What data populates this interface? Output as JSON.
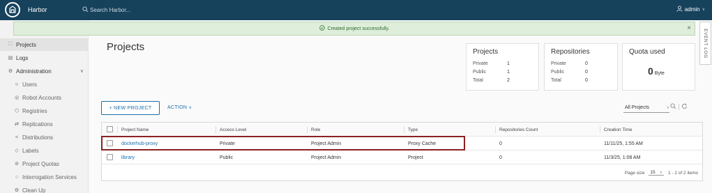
{
  "header": {
    "brand": "Harbor",
    "search_placeholder": "Search Harbor...",
    "user": "admin"
  },
  "sidebar": {
    "items": [
      {
        "label": "Projects",
        "icon": "projects-icon"
      },
      {
        "label": "Logs",
        "icon": "logs-icon"
      },
      {
        "label": "Administration",
        "icon": "administration-icon"
      },
      {
        "label": "Users",
        "icon": "users-icon"
      },
      {
        "label": "Robot Accounts",
        "icon": "robot-icon"
      },
      {
        "label": "Registries",
        "icon": "registries-icon"
      },
      {
        "label": "Replications",
        "icon": "replications-icon"
      },
      {
        "label": "Distributions",
        "icon": "distributions-icon"
      },
      {
        "label": "Labels",
        "icon": "labels-icon"
      },
      {
        "label": "Project Quotas",
        "icon": "quotas-icon"
      },
      {
        "label": "Interrogation Services",
        "icon": "interrogation-icon"
      },
      {
        "label": "Clean Up",
        "icon": "cleanup-icon"
      }
    ]
  },
  "alert": {
    "message": "Created project successfully.",
    "close": "×"
  },
  "event_log": "EVENT LOG",
  "page_title": "Projects",
  "cards": {
    "projects": {
      "title": "Projects",
      "rows": [
        {
          "k": "Private",
          "v": "1"
        },
        {
          "k": "Public",
          "v": "1"
        },
        {
          "k": "Total",
          "v": "2"
        }
      ]
    },
    "repositories": {
      "title": "Repositories",
      "rows": [
        {
          "k": "Private",
          "v": "0"
        },
        {
          "k": "Public",
          "v": "0"
        },
        {
          "k": "Total",
          "v": "0"
        }
      ]
    },
    "quota": {
      "title": "Quota used",
      "value": "0",
      "unit": "Byte"
    }
  },
  "toolbar": {
    "new_project": "+ NEW PROJECT",
    "action": "ACTION",
    "filter": "All Projects"
  },
  "table": {
    "columns": [
      "Project Name",
      "Access Level",
      "Role",
      "Type",
      "Repositories Count",
      "Creation Time"
    ],
    "rows": [
      [
        "dockerhub-proxy",
        "Private",
        "Project Admin",
        "Proxy Cache",
        "0",
        "11/11/25, 1:55 AM"
      ],
      [
        "library",
        "Public",
        "Project Admin",
        "Project",
        "0",
        "11/3/25, 1:08 AM"
      ]
    ],
    "page_size_label": "Page size",
    "page_size": "15",
    "range": "1 - 2 of 2 items"
  }
}
